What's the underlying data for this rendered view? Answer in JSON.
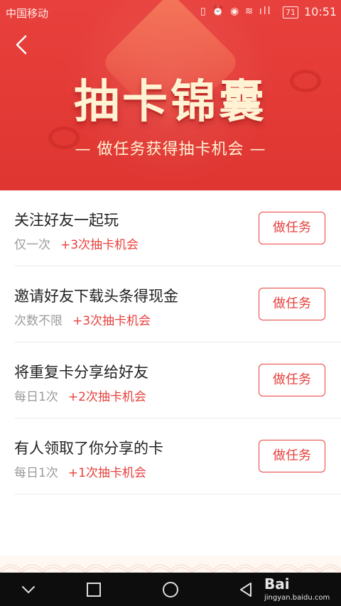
{
  "statusbar": {
    "carrier": "中国移动",
    "signal_icons": "▯ ⏰ ◉ ≋ ıll",
    "battery": "71",
    "time": "10:51"
  },
  "header": {
    "back_icon": "chevron-left-icon",
    "title": "抽卡锦囊",
    "subtitle": "— 做任务获得抽卡机会 —"
  },
  "tasks": [
    {
      "name": "关注好友一起玩",
      "frequency": "仅一次",
      "reward": "+3次抽卡机会",
      "button": "做任务"
    },
    {
      "name": "邀请好友下载头条得现金",
      "frequency": "次数不限",
      "reward": "+3次抽卡机会",
      "button": "做任务"
    },
    {
      "name": "将重复卡分享给好友",
      "frequency": "每日1次",
      "reward": "+2次抽卡机会",
      "button": "做任务"
    },
    {
      "name": "有人领取了你分享的卡",
      "frequency": "每日1次",
      "reward": "+1次抽卡机会",
      "button": "做任务"
    }
  ],
  "navbar": {
    "icons": [
      "chevron-down-icon",
      "square-icon",
      "circle-icon",
      "triangle-back-icon"
    ]
  },
  "watermark": {
    "line1": "Bai",
    "line2": "jingyan.baidu.com"
  },
  "colors": {
    "accent": "#e8403c",
    "title_text": "#fff3d4",
    "nav_background": "#0d0d0d"
  }
}
